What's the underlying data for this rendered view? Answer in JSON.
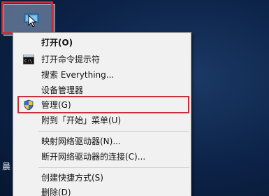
{
  "desktop": {
    "icon_name": "this-pc-icon",
    "left_edge_text": "晨"
  },
  "context_menu": {
    "items": [
      {
        "label": "打开(O)",
        "bold": true
      },
      {
        "label": "打开命令提示符",
        "icon": "cmd-icon"
      },
      {
        "label": "搜索 Everything..."
      },
      {
        "label": "设备管理器"
      },
      {
        "label": "管理(G)",
        "icon": "uac-shield-icon"
      },
      {
        "label": "附到「开始」菜单(U)"
      },
      {
        "label": "映射网络驱动器(N)..."
      },
      {
        "label": "断开网络驱动器的连接(C)..."
      },
      {
        "label": "创建快捷方式(S)"
      },
      {
        "label": "删除(D)"
      }
    ]
  },
  "colors": {
    "highlight_border": "#c8303a",
    "menu_background": "#f1f1f1"
  }
}
